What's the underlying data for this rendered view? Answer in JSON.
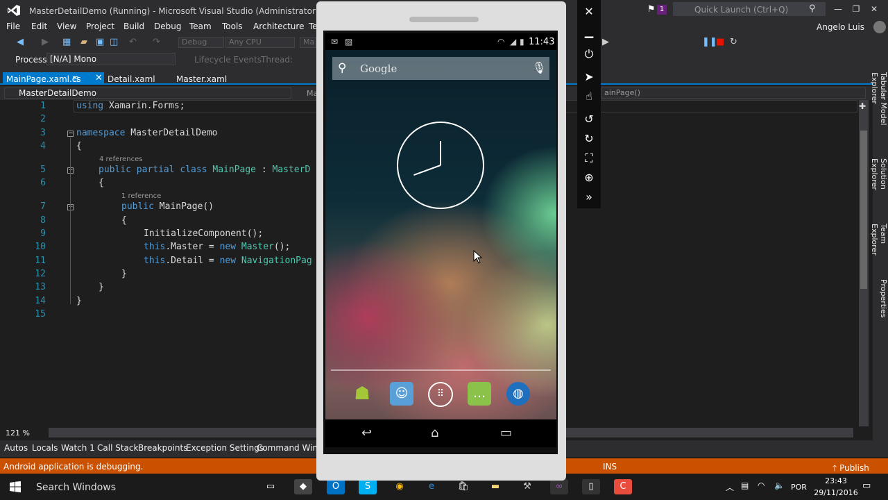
{
  "window": {
    "title": "MasterDetailDemo (Running) - Microsoft Visual Studio (Administrator)",
    "notification_count": "1",
    "quick_launch_placeholder": "Quick Launch (Ctrl+Q)",
    "user": "Angelo Luis"
  },
  "menu": [
    "File",
    "Edit",
    "View",
    "Project",
    "Build",
    "Debug",
    "Team",
    "Tools",
    "Architecture",
    "Te"
  ],
  "toolbar": {
    "config": "Debug",
    "platform": "Any CPU",
    "startup": "Ma"
  },
  "debugbar": {
    "process_label": "Process:",
    "process_value": "[N/A] Mono",
    "lifecycle": "Lifecycle Events",
    "thread": "Thread:"
  },
  "tabs": [
    {
      "label": "MainPage.xaml.cs",
      "active": true
    },
    {
      "label": "Detail.xaml",
      "active": false
    },
    {
      "label": "Master.xaml",
      "active": false
    }
  ],
  "navbar": {
    "project": "MasterDetailDemo",
    "member_fragment": "Ma",
    "method": "ainPage()"
  },
  "code": {
    "line_numbers": [
      "1",
      "2",
      "3",
      "4",
      "5",
      "6",
      "7",
      "8",
      "9",
      "10",
      "11",
      "12",
      "13",
      "14",
      "15"
    ],
    "lines": {
      "l1_kw": "using",
      "l1_rest": " Xamarin.Forms;",
      "l3_kw": "namespace",
      "l3_rest": " MasterDetailDemo",
      "l4": "{",
      "l5_refs": "4 references",
      "l5_kw": "public partial class",
      "l5_type": " MainPage",
      "l5_rest": " : ",
      "l5_base": "MasterD",
      "l6": "{",
      "l7_refs": "1 reference",
      "l7_kw": "public",
      "l7_rest": " MainPage()",
      "l8": "{",
      "l9": "InitializeComponent();",
      "l10_kw1": "this",
      "l10_mid": ".Master = ",
      "l10_kw2": "new",
      "l10_type": " Master",
      "l10_end": "();",
      "l11_kw1": "this",
      "l11_mid": ".Detail = ",
      "l11_kw2": "new",
      "l11_type": " NavigationPag",
      "l12": "}",
      "l13": "}",
      "l14": "}"
    }
  },
  "zoom": "121 %",
  "right_panel_tabs": [
    "Tabular Model Explorer",
    "Solution Explorer",
    "Team Explorer",
    "Properties"
  ],
  "bottom_tabs": [
    "Autos",
    "Locals",
    "Watch 1",
    "Call Stack",
    "Breakpoints",
    "Exception Settings",
    "Command Windo"
  ],
  "status": {
    "text": "Android application is debugging.",
    "mode": "INS",
    "publish": "Publish"
  },
  "taskbar": {
    "search": "Search Windows",
    "lang": "POR",
    "time": "23:43",
    "date": "29/11/2016"
  },
  "phone": {
    "time": "11:43",
    "search_text": "Google",
    "colors": {
      "screen_bg": "#0d2c38",
      "nav_bg": "#000000"
    },
    "clock": {
      "hour_hand_angle": 250,
      "minute_hand_angle": 0
    }
  },
  "colors": {
    "accent": "#007acc",
    "status_bar": "#ca5100",
    "chrome": "#2d2d30",
    "editor_bg": "#1e1e1e"
  }
}
